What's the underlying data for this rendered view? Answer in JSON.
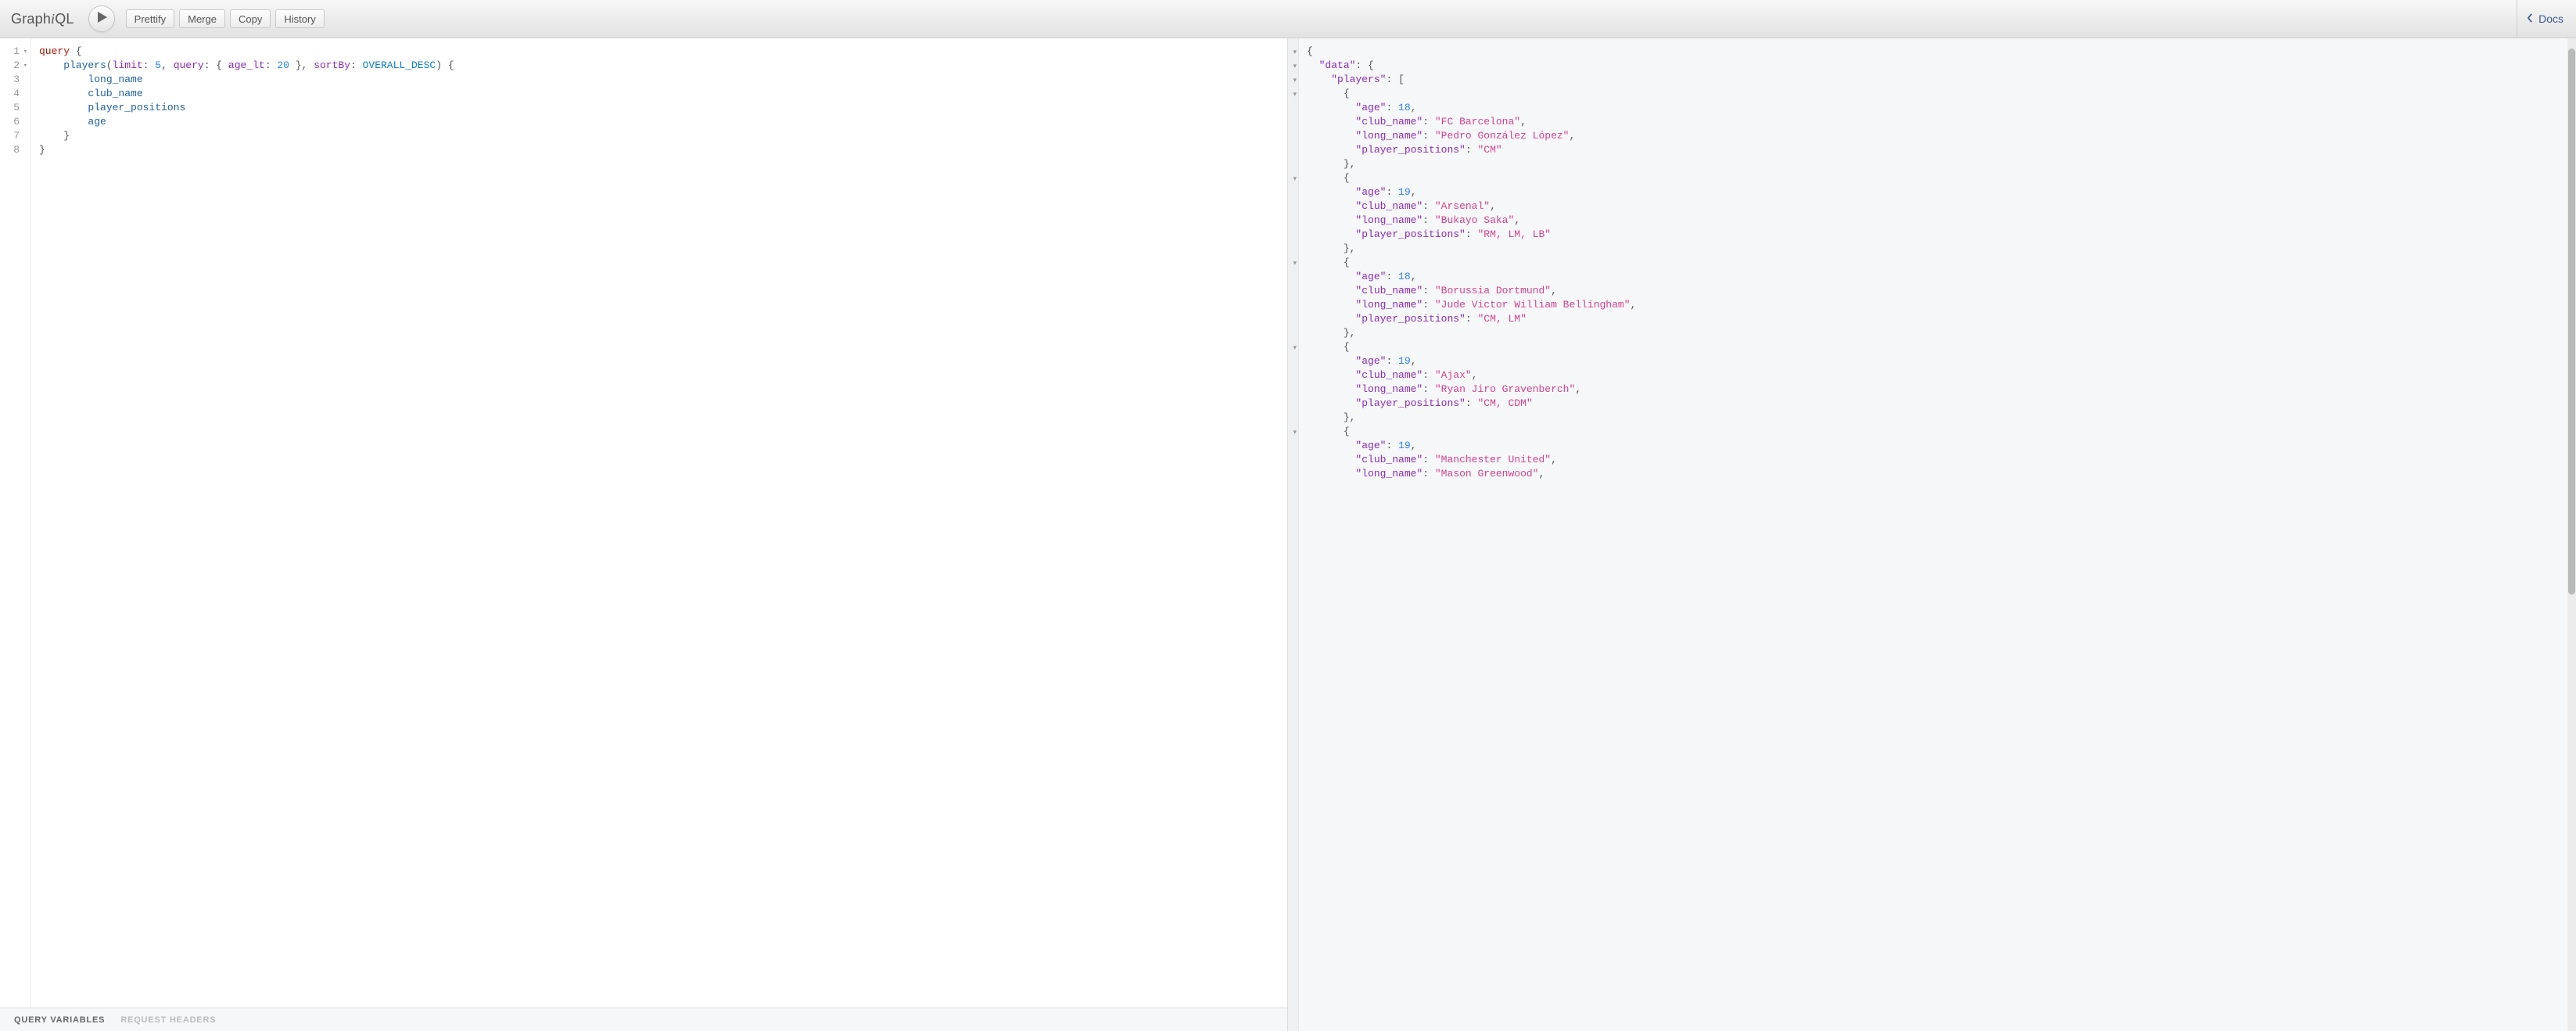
{
  "app": {
    "title": "GraphiQL"
  },
  "toolbar": {
    "prettify": "Prettify",
    "merge": "Merge",
    "copy": "Copy",
    "history": "History",
    "docs": "Docs"
  },
  "editor": {
    "line_count": 8,
    "fold_lines": [
      1,
      2
    ],
    "tokens": [
      [
        {
          "t": "kw",
          "v": "query"
        },
        {
          "t": "punc",
          "v": " {"
        }
      ],
      [
        {
          "t": "punc",
          "v": "    "
        },
        {
          "t": "def",
          "v": "players"
        },
        {
          "t": "punc",
          "v": "("
        },
        {
          "t": "attr",
          "v": "limit"
        },
        {
          "t": "punc",
          "v": ": "
        },
        {
          "t": "num",
          "v": "5"
        },
        {
          "t": "punc",
          "v": ", "
        },
        {
          "t": "attr",
          "v": "query"
        },
        {
          "t": "punc",
          "v": ": { "
        },
        {
          "t": "attr",
          "v": "age_lt"
        },
        {
          "t": "punc",
          "v": ": "
        },
        {
          "t": "num",
          "v": "20"
        },
        {
          "t": "punc",
          "v": " }, "
        },
        {
          "t": "attr",
          "v": "sortBy"
        },
        {
          "t": "punc",
          "v": ": "
        },
        {
          "t": "enum",
          "v": "OVERALL_DESC"
        },
        {
          "t": "punc",
          "v": ") {"
        }
      ],
      [
        {
          "t": "punc",
          "v": "        "
        },
        {
          "t": "prop",
          "v": "long_name"
        }
      ],
      [
        {
          "t": "punc",
          "v": "        "
        },
        {
          "t": "prop",
          "v": "club_name"
        }
      ],
      [
        {
          "t": "punc",
          "v": "        "
        },
        {
          "t": "prop",
          "v": "player_positions"
        }
      ],
      [
        {
          "t": "punc",
          "v": "        "
        },
        {
          "t": "prop",
          "v": "age"
        }
      ],
      [
        {
          "t": "punc",
          "v": "    }"
        }
      ],
      [
        {
          "t": "punc",
          "v": "}"
        }
      ]
    ]
  },
  "variable_tabs": {
    "query_variables": "QUERY VARIABLES",
    "request_headers": "REQUEST HEADERS",
    "active": "query_variables"
  },
  "result": {
    "fold_lines": [
      1,
      2,
      3,
      4,
      10,
      16,
      22,
      28
    ],
    "data": {
      "players": [
        {
          "age": 18,
          "club_name": "FC Barcelona",
          "long_name": "Pedro González López",
          "player_positions": "CM"
        },
        {
          "age": 19,
          "club_name": "Arsenal",
          "long_name": "Bukayo Saka",
          "player_positions": "RM, LM, LB"
        },
        {
          "age": 18,
          "club_name": "Borussia Dortmund",
          "long_name": "Jude Victor William Bellingham",
          "player_positions": "CM, LM"
        },
        {
          "age": 19,
          "club_name": "Ajax",
          "long_name": "Ryan Jiro Gravenberch",
          "player_positions": "CM, CDM"
        },
        {
          "age": 19,
          "club_name": "Manchester United",
          "long_name": "Mason Greenwood",
          "player_positions": ""
        }
      ]
    },
    "truncate_last": true
  },
  "scrollbar": {
    "top_pct": 1,
    "height_pct": 55
  }
}
